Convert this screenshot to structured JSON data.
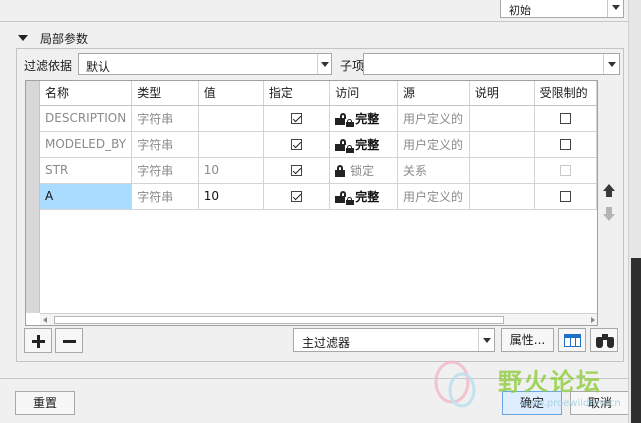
{
  "top": {
    "combo_value": "初始"
  },
  "section": {
    "title": "局部参数"
  },
  "filter": {
    "label": "过滤依据",
    "value": "默认",
    "sub_label": "子项",
    "sub_value": ""
  },
  "table": {
    "columns": [
      "名称",
      "类型",
      "值",
      "指定",
      "访问",
      "源",
      "说明",
      "受限制的"
    ],
    "rows": [
      {
        "name": "DESCRIPTION",
        "type": "字符串",
        "value": "",
        "designated": true,
        "access": "完整",
        "source": "用户定义的",
        "desc": "",
        "restricted": false,
        "style": "grey"
      },
      {
        "name": "MODELED_BY",
        "type": "字符串",
        "value": "",
        "designated": true,
        "access": "完整",
        "source": "用户定义的",
        "desc": "",
        "restricted": false,
        "style": "grey"
      },
      {
        "name": "STR",
        "type": "字符串",
        "value": "10",
        "designated": true,
        "access": "锁定",
        "source": "关系",
        "desc": "",
        "restricted": false,
        "style": "locked"
      },
      {
        "name": "A",
        "type": "字符串",
        "value": "10",
        "designated": true,
        "access": "完整",
        "source": "用户定义的",
        "desc": "",
        "restricted": false,
        "style": "selected"
      }
    ]
  },
  "toolbar": {
    "main_filter": "主过滤器",
    "properties_label": "属性..."
  },
  "footer": {
    "reset_label": "重置",
    "ok_label": "确定",
    "cancel_label": "取消"
  },
  "watermark": {
    "text": "野火论坛",
    "url": "www.proewildfire.cn"
  },
  "colors": {
    "selection": "#aadcff",
    "watermark_green": "#8fcc3a",
    "accent_blue": "#1f6fc8"
  },
  "icons": [
    "triangle-down-icon",
    "lock-icon",
    "unlock-icon",
    "checkbox-icon",
    "move-up-icon",
    "move-down-icon",
    "plus-icon",
    "minus-icon",
    "table-view-icon",
    "binoculars-icon"
  ]
}
